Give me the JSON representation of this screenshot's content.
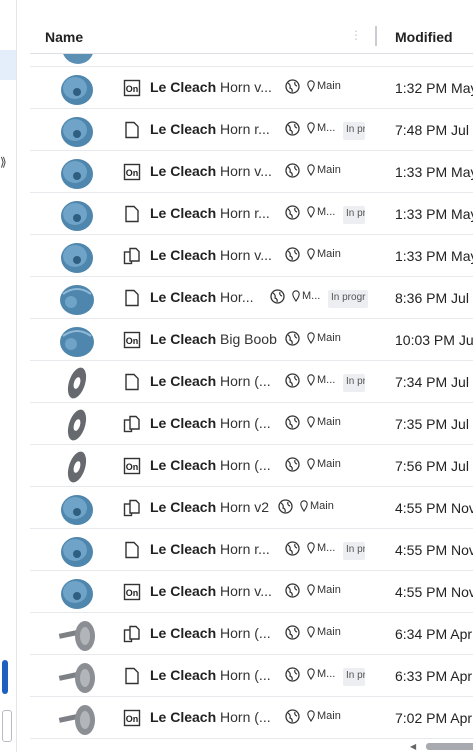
{
  "header": {
    "name_label": "Name",
    "modified_label": "Modified"
  },
  "rows": [
    {
      "thumb": "horn",
      "type": "onshape",
      "bold": "Le Cleach",
      "rest": " Horn v...",
      "branch": "Main",
      "badge": "",
      "date": "1:32 PM May"
    },
    {
      "thumb": "horn",
      "type": "document",
      "bold": "Le Cleach",
      "rest": " Horn r...",
      "branch": "M...",
      "badge": "In pro",
      "date": "7:48 PM Jul"
    },
    {
      "thumb": "horn",
      "type": "onshape",
      "bold": "Le Cleach",
      "rest": " Horn v...",
      "branch": "Main",
      "badge": "",
      "date": "1:33 PM May"
    },
    {
      "thumb": "horn",
      "type": "document",
      "bold": "Le Cleach",
      "rest": " Horn r...",
      "branch": "M...",
      "badge": "In pro",
      "date": "1:33 PM May"
    },
    {
      "thumb": "horn",
      "type": "copy",
      "bold": "Le Cleach",
      "rest": " Horn v...",
      "branch": "Main",
      "badge": "",
      "date": "1:33 PM May"
    },
    {
      "thumb": "bowl",
      "type": "document",
      "bold": "Le Cleach",
      "rest": " Hor...",
      "branch": "M...",
      "badge": "In progr",
      "date": "8:36 PM Jul"
    },
    {
      "thumb": "bowl",
      "type": "onshape",
      "bold": "Le Cleach",
      "rest": " Big Boob",
      "branch": "Main",
      "badge": "",
      "date": "10:03 PM Ju"
    },
    {
      "thumb": "ring",
      "type": "document",
      "bold": "Le Cleach",
      "rest": " Horn (...",
      "branch": "M...",
      "badge": "In pro",
      "date": "7:34 PM Jul"
    },
    {
      "thumb": "ring",
      "type": "copy",
      "bold": "Le Cleach",
      "rest": " Horn (...",
      "branch": "Main",
      "badge": "",
      "date": "7:35 PM Jul"
    },
    {
      "thumb": "ring",
      "type": "onshape",
      "bold": "Le Cleach",
      "rest": " Horn (...",
      "branch": "Main",
      "badge": "",
      "date": "7:56 PM Jul"
    },
    {
      "thumb": "horn",
      "type": "copy",
      "bold": "Le Cleach",
      "rest": " Horn v2",
      "branch": "Main",
      "badge": "",
      "date": "4:55 PM Nov"
    },
    {
      "thumb": "horn",
      "type": "document",
      "bold": "Le Cleach",
      "rest": " Horn r...",
      "branch": "M...",
      "badge": "In pro",
      "date": "4:55 PM Nov"
    },
    {
      "thumb": "horn",
      "type": "onshape",
      "bold": "Le Cleach",
      "rest": " Horn v...",
      "branch": "Main",
      "badge": "",
      "date": "4:55 PM Nov"
    },
    {
      "thumb": "grey",
      "type": "copy",
      "bold": "Le Cleach",
      "rest": " Horn (...",
      "branch": "Main",
      "badge": "",
      "date": "6:34 PM Apr"
    },
    {
      "thumb": "grey",
      "type": "document",
      "bold": "Le Cleach",
      "rest": " Horn (...",
      "branch": "M...",
      "badge": "In pro",
      "date": "6:33 PM Apr"
    },
    {
      "thumb": "grey",
      "type": "onshape",
      "bold": "Le Cleach",
      "rest": " Horn (...",
      "branch": "Main",
      "badge": "",
      "date": "7:02 PM Apr"
    }
  ],
  "type_labels": {
    "onshape": "On"
  },
  "colors": {
    "accent": "#1f5fbf",
    "horn_blue": "#5b8fb3",
    "badge_bg": "#eceef1"
  }
}
